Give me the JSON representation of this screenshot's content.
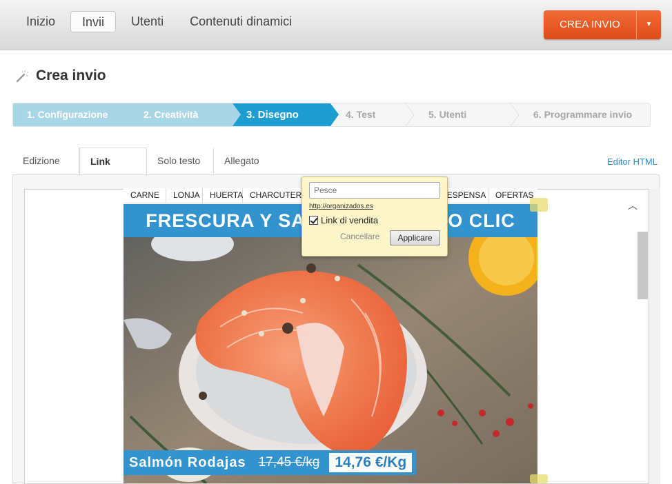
{
  "topnav": {
    "items": [
      {
        "label": "Inizio",
        "active": false
      },
      {
        "label": "Invii",
        "active": true
      },
      {
        "label": "Utenti",
        "active": false
      },
      {
        "label": "Contenuti dinamici",
        "active": false
      }
    ],
    "cta_label": "CREA INVIO",
    "cta_caret_icon": "caret-down-icon",
    "cta_color": "#e8531f"
  },
  "page": {
    "title": "Crea invio",
    "title_icon": "magic-wand-icon"
  },
  "steps": [
    {
      "label": "1. Configurazione",
      "state": "done"
    },
    {
      "label": "2. Creatività",
      "state": "done"
    },
    {
      "label": "3. Disegno",
      "state": "current"
    },
    {
      "label": "4. Test",
      "state": "todo"
    },
    {
      "label": "5. Utenti",
      "state": "todo"
    },
    {
      "label": "6. Programmare invio",
      "state": "todo"
    }
  ],
  "tabs": [
    {
      "label": "Edizione",
      "active": false
    },
    {
      "label": "Link",
      "active": true
    },
    {
      "label": "Solo testo",
      "active": false
    },
    {
      "label": "Allegato",
      "active": false
    }
  ],
  "html_editor_link": "Editor HTML",
  "email": {
    "menu": [
      "CARNE",
      "LONJA",
      "HUERTA",
      "CHARCUTERÍA",
      "",
      "",
      "DESPENSA",
      "OFERTAS"
    ],
    "banner": "FRESCURA Y SABOR A UN SOLO CLIC",
    "banner_color": "#3293cf",
    "product_name": "Salmón Rodajas",
    "old_price": "17,45 €/kg",
    "new_price": "14,76 €/Kg"
  },
  "link_popover": {
    "input_placeholder": "Pesce",
    "url": "http://organizados.es",
    "checkbox_label": "Link di vendita",
    "checkbox_checked": true,
    "cancel_label": "Cancellare",
    "apply_label": "Applicare",
    "bg_color": "#fdf6cb"
  }
}
